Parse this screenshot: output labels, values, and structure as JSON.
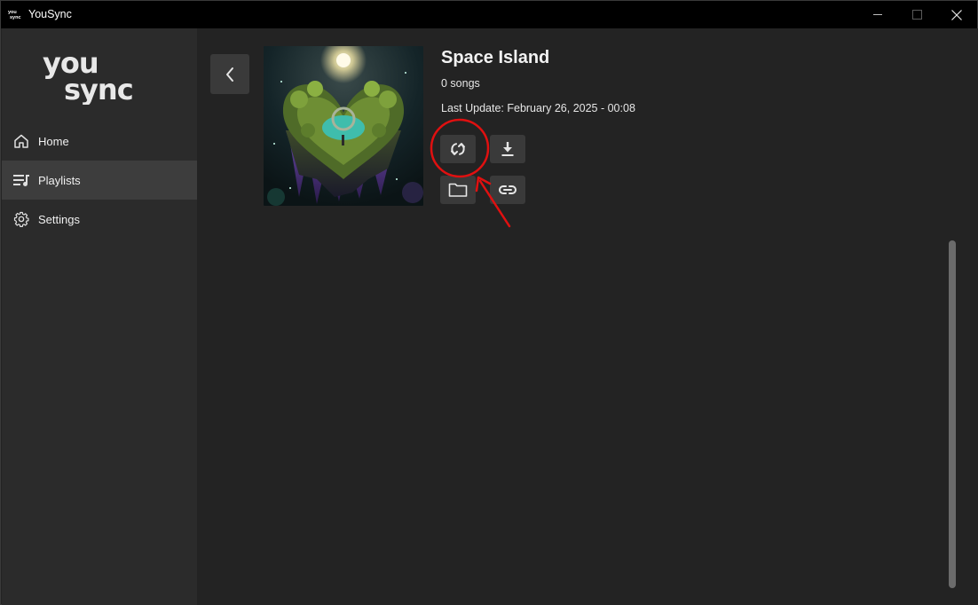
{
  "window": {
    "title": "YouSync"
  },
  "sidebar": {
    "items": [
      {
        "label": "Home",
        "icon": "home-icon"
      },
      {
        "label": "Playlists",
        "icon": "playlist-icon",
        "active": true
      },
      {
        "label": "Settings",
        "icon": "gear-icon"
      }
    ]
  },
  "playlist": {
    "title": "Space Island",
    "song_count": "0 songs",
    "last_update": "Last Update: February 26, 2025 - 00:08",
    "actions": [
      {
        "name": "sync",
        "icon": "sync-icon"
      },
      {
        "name": "download",
        "icon": "download-icon"
      },
      {
        "name": "open-folder",
        "icon": "folder-icon"
      },
      {
        "name": "copy-link",
        "icon": "link-icon"
      }
    ]
  },
  "colors": {
    "background": "#232323",
    "sidebar": "#2b2b2b",
    "sidebar_active": "#3d3d3d",
    "button": "#3a3a3a",
    "annotation": "#e01010"
  }
}
